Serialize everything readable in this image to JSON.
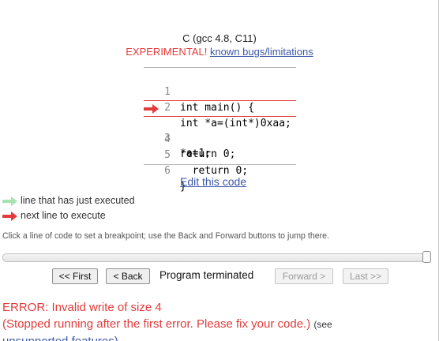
{
  "header": {
    "language": "C (gcc 4.8, C11)",
    "experimental": "EXPERIMENTAL!",
    "known_bugs_link": "known bugs/limitations"
  },
  "code": {
    "lines": [
      {
        "num": "1",
        "text": "int main() {"
      },
      {
        "num": "2",
        "text": "int *a=(int*)0xaa;"
      },
      {
        "num": "3",
        "text": "*a=1;"
      },
      {
        "num": "4",
        "text": "return 0;"
      },
      {
        "num": "5",
        "text": "  return 0;"
      },
      {
        "num": "6",
        "text": "}"
      }
    ],
    "next_line_index": 3,
    "colors": {
      "next_arrow": "#e33b3b",
      "executed_arrow": "#a8e2b0"
    }
  },
  "edit_link": "Edit this code",
  "legend": {
    "executed": "line that has just executed",
    "next": "next line to execute"
  },
  "hint": "Click a line of code to set a breakpoint; use the Back and Forward buttons to jump there.",
  "slider": {
    "position_fraction": 1.0
  },
  "controls": {
    "first": "<< First",
    "back": "< Back",
    "status": "Program terminated",
    "forward": "Forward >",
    "last": "Last >>"
  },
  "error": {
    "line1": "ERROR: Invalid write of size 4",
    "line2": "(Stopped running after the first error. Please fix your code.)",
    "see": "(see",
    "cut_text": "unsupported features)"
  }
}
